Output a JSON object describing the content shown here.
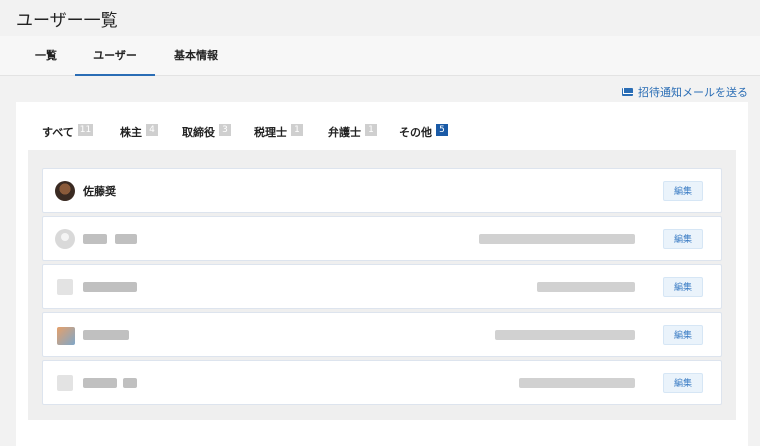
{
  "header": {
    "title": "ユーザー一覧"
  },
  "top_tabs": [
    {
      "label": "一覧"
    },
    {
      "label": "ユーザー"
    },
    {
      "label": "基本情報"
    }
  ],
  "active_top_tab": "ユーザー",
  "invite_link": {
    "label": "招待通知メールを送る",
    "icon": "mail-icon"
  },
  "sub_tabs": [
    {
      "label": "すべて",
      "count": "11"
    },
    {
      "label": "株主",
      "count": "4"
    },
    {
      "label": "取締役",
      "count": "3"
    },
    {
      "label": "税理士",
      "count": "1"
    },
    {
      "label": "弁護士",
      "count": "1"
    },
    {
      "label": "その他",
      "count": "5"
    }
  ],
  "active_sub_tab": "その他",
  "users": [
    {
      "name": "佐藤奨",
      "edit_label": "編集"
    },
    {
      "name": "",
      "edit_label": "編集"
    },
    {
      "name": "",
      "edit_label": "編集"
    },
    {
      "name": "",
      "edit_label": "編集"
    },
    {
      "name": "",
      "edit_label": "編集"
    }
  ],
  "colors": {
    "accent": "#2a6db5",
    "active_badge": "#1a5aa6",
    "badge": "#cfcfcf"
  }
}
